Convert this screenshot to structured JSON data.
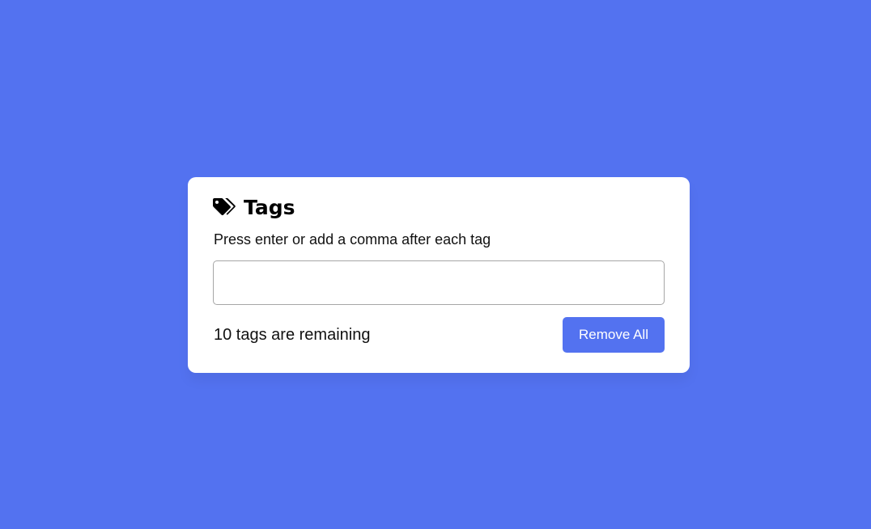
{
  "page": {
    "background_color": "#5372f0"
  },
  "card": {
    "title": "Tags",
    "title_icon": "tags-icon",
    "hint": "Press enter or add a comma after each tag",
    "input": {
      "value": "",
      "placeholder": ""
    },
    "remaining_text": "10 tags are remaining",
    "remove_all_label": "Remove All",
    "accent_color": "#5372f0"
  }
}
